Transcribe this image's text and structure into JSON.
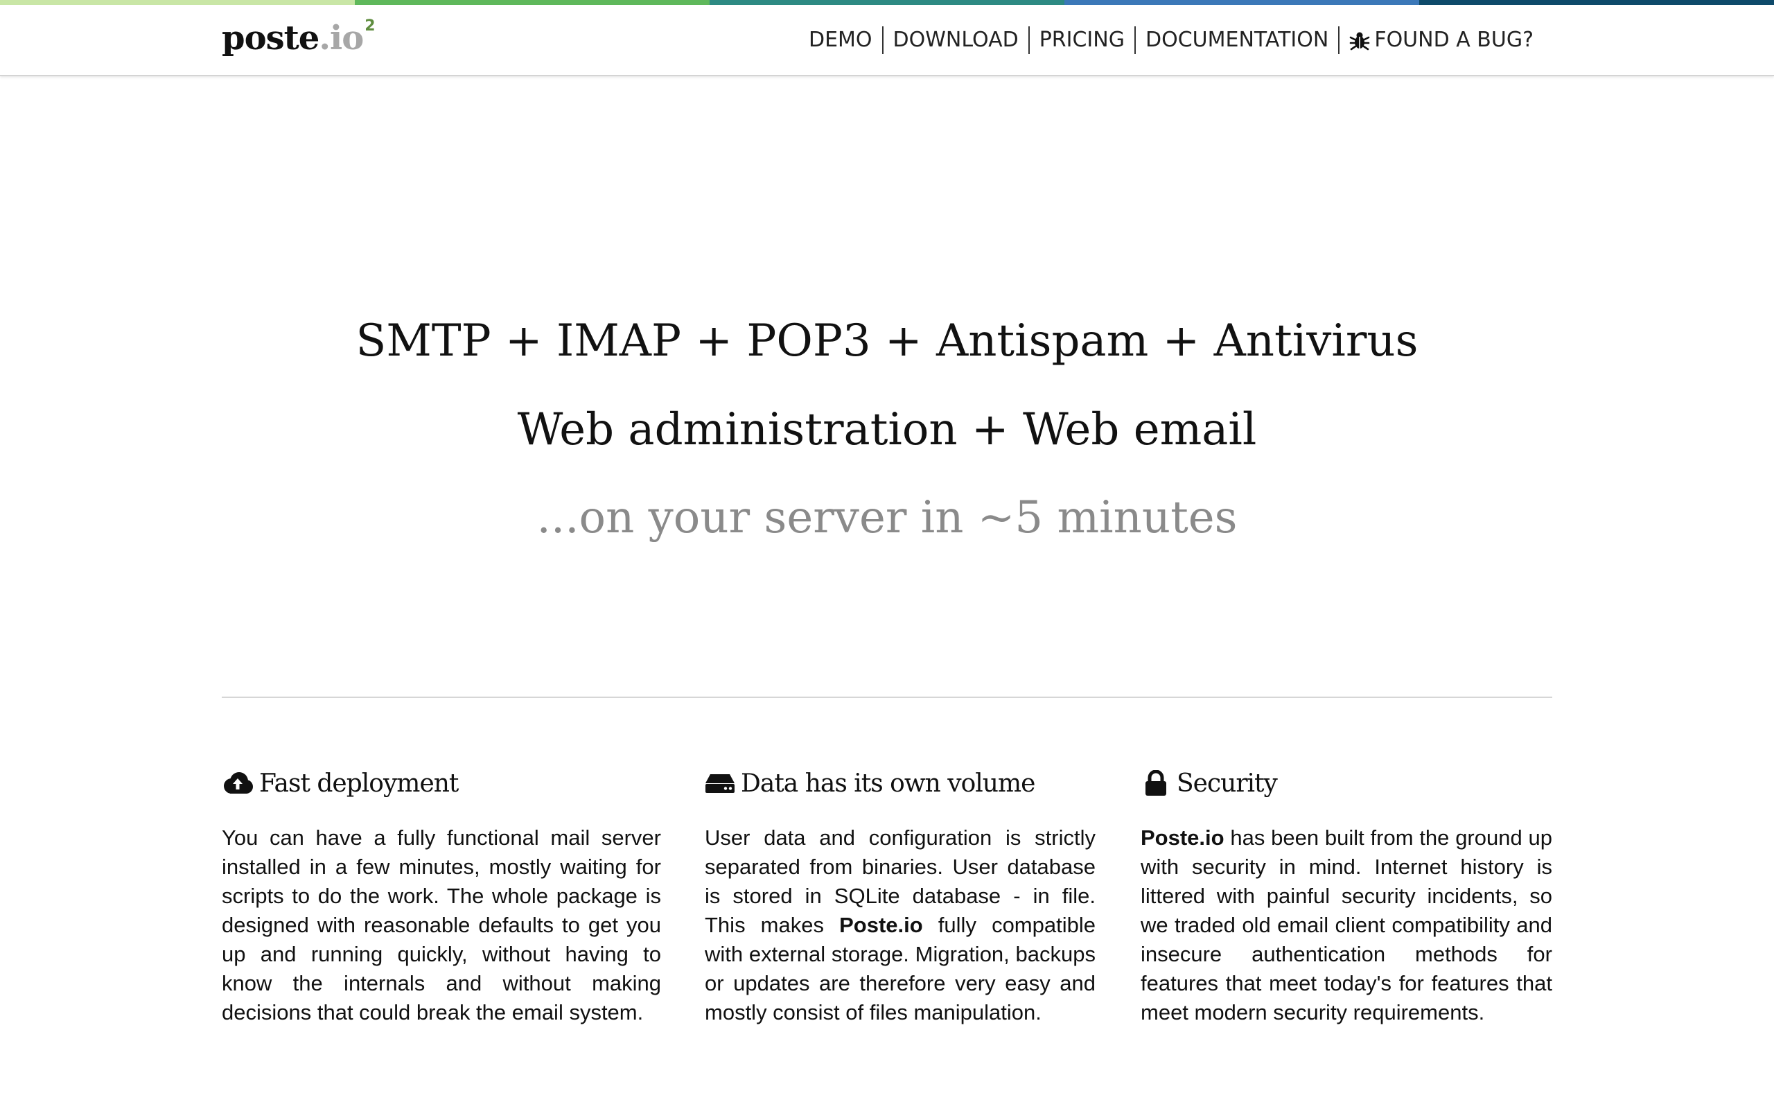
{
  "colors": {
    "top_bar": [
      "#c9e6a6",
      "#5fb85b",
      "#2d8a83",
      "#3b78b8",
      "#0e4a6a"
    ],
    "logo_superscript": "#5f8d3f",
    "hero_muted": "#8a8a8a"
  },
  "header": {
    "logo": {
      "name": "poste",
      "tld": ".io",
      "sup": "2"
    },
    "nav": [
      {
        "label": "DEMO"
      },
      {
        "label": "DOWNLOAD"
      },
      {
        "label": "PRICING"
      },
      {
        "label": "DOCUMENTATION"
      },
      {
        "label": "FOUND A BUG?",
        "icon": "bug-icon"
      }
    ]
  },
  "hero": {
    "line1": "SMTP + IMAP + POP3 + Antispam + Antivirus",
    "line2": "Web administration + Web email",
    "line3": "...on your server in ~5 minutes"
  },
  "features": [
    {
      "icon": "cloud-upload-icon",
      "title": "Fast deployment",
      "text": "You can have a fully functional mail server installed in a few minutes, mostly waiting for scripts to do the work. The whole package is designed with reasonable defaults to get you up and running quickly, without having to know the internals and without making decisions that could break the email system."
    },
    {
      "icon": "hard-drive-icon",
      "title": "Data has its own volume",
      "text_before": "User data and configuration is strictly separated from binaries. User database is stored in SQLite database - in file. This makes ",
      "strong": "Poste.io",
      "text_after": " fully compatible with external storage. Migration, backups or updates are therefore very easy and mostly consist of files manipulation."
    },
    {
      "icon": "lock-icon",
      "strong": "Poste.io",
      "text_after": " has been built from the ground up with security in mind. Internet history is littered with painful security incidents, so we traded old email client compatibility and insecure authentication methods for features that meet today's for features that meet modern security requirements.",
      "title": "Security"
    }
  ]
}
